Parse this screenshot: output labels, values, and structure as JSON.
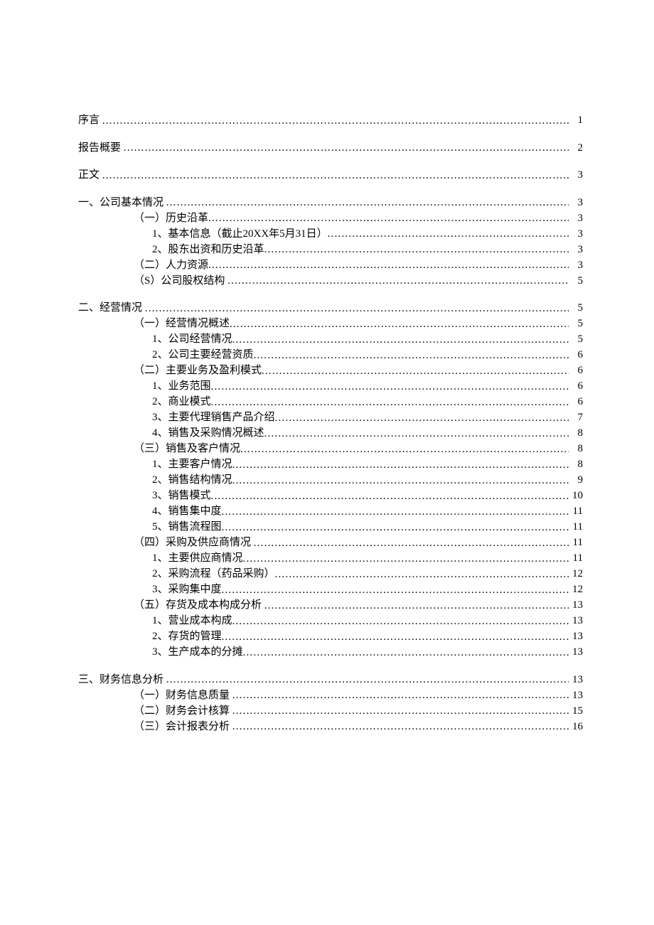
{
  "toc": [
    {
      "level": 0,
      "gap": true,
      "title": "序言",
      "spaced": true,
      "page": "1"
    },
    {
      "level": 0,
      "gap": true,
      "title": "报告概要",
      "spaced": true,
      "page": "2"
    },
    {
      "level": 0,
      "gap": true,
      "title": "正文",
      "spaced": true,
      "page": "3"
    },
    {
      "level": 0,
      "gap": true,
      "title": "一、公司基本情况",
      "spaced": true,
      "page": "3"
    },
    {
      "level": 1,
      "gap": false,
      "title": "（一）历史沿革",
      "page": "3"
    },
    {
      "level": 2,
      "gap": false,
      "title": "1、基本信息（截止20XX年5月31日）",
      "page": "3"
    },
    {
      "level": 2,
      "gap": false,
      "title": "2、股东出资和历史沿革",
      "page": "3"
    },
    {
      "level": 1,
      "gap": false,
      "title": "（二）人力资源",
      "page": "3"
    },
    {
      "level": 1,
      "gap": false,
      "title": "（S）公司股权结构",
      "spaced": true,
      "page": "5"
    },
    {
      "level": 0,
      "gap": true,
      "title": "二、经营情况",
      "spaced": true,
      "page": "5"
    },
    {
      "level": 1,
      "gap": false,
      "title": "（一）经营情况概述",
      "page": "5"
    },
    {
      "level": 2,
      "gap": false,
      "title": "1、公司经营情况",
      "page": "5"
    },
    {
      "level": 2,
      "gap": false,
      "title": "2、公司主要经营资质",
      "page": "6"
    },
    {
      "level": 1,
      "gap": false,
      "title": "（二）主要业务及盈利模式",
      "page": "6"
    },
    {
      "level": 2,
      "gap": false,
      "title": "1、业务范围",
      "page": "6"
    },
    {
      "level": 2,
      "gap": false,
      "title": "2、商业模式",
      "page": "6"
    },
    {
      "level": 2,
      "gap": false,
      "title": "3、主要代理销售产品介绍",
      "page": "7"
    },
    {
      "level": 2,
      "gap": false,
      "title": "4、销售及采购情况概述",
      "page": "8"
    },
    {
      "level": 1,
      "gap": false,
      "title": "（三）销售及客户情况",
      "page": "8"
    },
    {
      "level": 2,
      "gap": false,
      "title": "1、主要客户情况",
      "page": "8"
    },
    {
      "level": 2,
      "gap": false,
      "title": "2、销售结构情况",
      "page": "9"
    },
    {
      "level": 2,
      "gap": false,
      "title": "3、销售模式",
      "page": "10"
    },
    {
      "level": 2,
      "gap": false,
      "title": "4、销售集中度",
      "page": "11"
    },
    {
      "level": 2,
      "gap": false,
      "title": "5、销售流程图",
      "page": "11"
    },
    {
      "level": 1,
      "gap": false,
      "title": "（四）采购及供应商情况",
      "spaced": true,
      "page": "11"
    },
    {
      "level": 2,
      "gap": false,
      "title": "1、主要供应商情况",
      "page": "11"
    },
    {
      "level": 2,
      "gap": false,
      "title": "2、采购流程（药品采购）",
      "page": "12"
    },
    {
      "level": 2,
      "gap": false,
      "title": "3、采购集中度",
      "page": "12"
    },
    {
      "level": 1,
      "gap": false,
      "title": "（五）存货及成本构成分析",
      "spaced": true,
      "page": "13"
    },
    {
      "level": 2,
      "gap": false,
      "title": "1、营业成本构成",
      "page": "13"
    },
    {
      "level": 2,
      "gap": false,
      "title": "2、存货的管理",
      "page": "13"
    },
    {
      "level": 2,
      "gap": false,
      "title": "3、生产成本的分摊",
      "page": "13"
    },
    {
      "level": 0,
      "gap": true,
      "title": "三、财务信息分析",
      "spaced": true,
      "page": "13"
    },
    {
      "level": 1,
      "gap": false,
      "title": "（一）财务信息质量",
      "spaced": true,
      "page": "13"
    },
    {
      "level": 1,
      "gap": false,
      "title": "（二）财务会计核算",
      "spaced": true,
      "page": "15"
    },
    {
      "level": 1,
      "gap": false,
      "title": "（三）会计报表分析",
      "spaced": true,
      "page": "16"
    }
  ]
}
